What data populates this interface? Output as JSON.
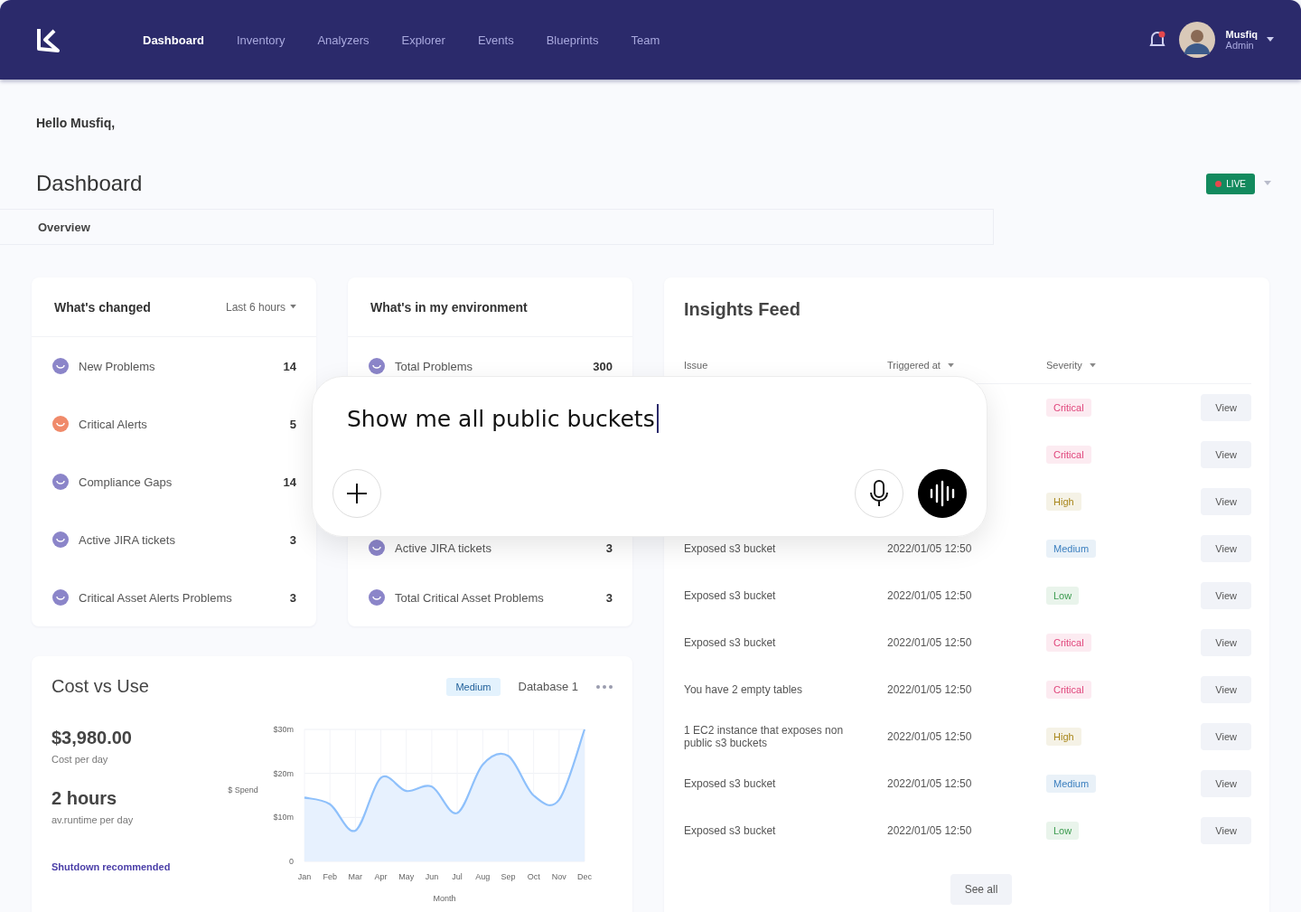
{
  "nav": {
    "items": [
      {
        "label": "Dashboard",
        "selected": true
      },
      {
        "label": "Inventory",
        "selected": false
      },
      {
        "label": "Analyzers",
        "selected": false
      },
      {
        "label": "Explorer",
        "selected": false
      },
      {
        "label": "Events",
        "selected": false
      },
      {
        "label": "Blueprints",
        "selected": false
      },
      {
        "label": "Team",
        "selected": false
      }
    ],
    "user": {
      "name": "Musfiq",
      "role": "Admin"
    }
  },
  "greeting": "Hello Musfiq,",
  "page_title": "Dashboard",
  "live_badge": "LIVE",
  "tabs": [
    {
      "label": "Overview",
      "selected": true
    }
  ],
  "changed": {
    "title": "What's changed",
    "range": "Last 6 hours",
    "items": [
      {
        "label": "New Problems",
        "count": "14",
        "color": "#8b85c9"
      },
      {
        "label": "Critical Alerts",
        "count": "5",
        "color": "#f08a6a"
      },
      {
        "label": "Compliance Gaps",
        "count": "14",
        "color": "#8b85c9"
      },
      {
        "label": "Active JIRA tickets",
        "count": "3",
        "color": "#8b85c9"
      },
      {
        "label": "Critical Asset Alerts Problems",
        "count": "3",
        "color": "#8b85c9"
      }
    ]
  },
  "environment": {
    "title": "What's in my environment",
    "items": [
      {
        "label": "Total Problems",
        "count": "300",
        "color": "#8b85c9"
      },
      {
        "label": "Active JIRA tickets",
        "count": "3",
        "color": "#8b85c9"
      },
      {
        "label": "Total Critical Asset Problems",
        "count": "3",
        "color": "#8b85c9"
      }
    ]
  },
  "cost": {
    "title": "Cost vs Use",
    "tag": "Medium",
    "database": "Database 1",
    "amount": "$3,980.00",
    "amount_caption": "Cost per day",
    "runtime": "2 hours",
    "runtime_caption": "av.runtime per day",
    "link": "Shutdown recommended",
    "chart_data": {
      "type": "area",
      "xlabel": "Month",
      "ylabel": "$ Spend",
      "categories": [
        "Jan",
        "Feb",
        "Mar",
        "Apr",
        "May",
        "Jun",
        "Jul",
        "Aug",
        "Sep",
        "Oct",
        "Nov",
        "Dec"
      ],
      "series": [
        {
          "color": "#8ec0fb",
          "values": [
            14.5,
            13,
            7,
            19,
            16,
            17,
            11,
            22,
            24,
            15,
            14,
            30
          ]
        }
      ],
      "ylim": [
        0,
        30
      ],
      "grid": true,
      "yticks": [
        {
          "value": 0,
          "label": "0"
        },
        {
          "value": 10,
          "label": "$10m"
        },
        {
          "value": 20,
          "label": "$20m"
        },
        {
          "value": 30,
          "label": "$30m"
        }
      ]
    }
  },
  "insights": {
    "title": "Insights Feed",
    "columns": [
      "Issue",
      "Triggered at",
      "Severity"
    ],
    "rows": [
      {
        "severity": "Critical",
        "color": "#e0457b",
        "action": "View"
      },
      {
        "severity": "Critical",
        "color": "#e0457b",
        "action": "View"
      },
      {
        "severity": "High",
        "color": "#a8861a",
        "action": "View"
      },
      {
        "issue": "Exposed s3 bucket",
        "time": "2022/01/05  12:50",
        "severity": "Medium",
        "color": "#3b7fbf",
        "action": "View"
      },
      {
        "issue": "Exposed s3 bucket",
        "time": "2022/01/05  12:50",
        "severity": "Low",
        "color": "#3a9a4d",
        "action": "View"
      },
      {
        "issue": "Exposed s3 bucket",
        "time": "2022/01/05  12:50",
        "severity": "Critical",
        "color": "#e0457b",
        "action": "View"
      },
      {
        "issue": "You have 2 empty tables",
        "time": "2022/01/05  12:50",
        "severity": "Critical",
        "color": "#e0457b",
        "action": "View"
      },
      {
        "issue": "1 EC2 instance that exposes non public s3 buckets",
        "time": "2022/01/05  12:50",
        "severity": "High",
        "color": "#a8861a",
        "action": "View"
      },
      {
        "issue": "Exposed s3 bucket",
        "time": "2022/01/05  12:50",
        "severity": "Medium",
        "color": "#3b7fbf",
        "action": "View"
      },
      {
        "issue": "Exposed s3 bucket",
        "time": "2022/01/05  12:50",
        "severity": "Low",
        "color": "#3a9a4d",
        "action": "View"
      }
    ],
    "see_all": "See all"
  },
  "prompt": {
    "value": "Show me all public buckets"
  }
}
